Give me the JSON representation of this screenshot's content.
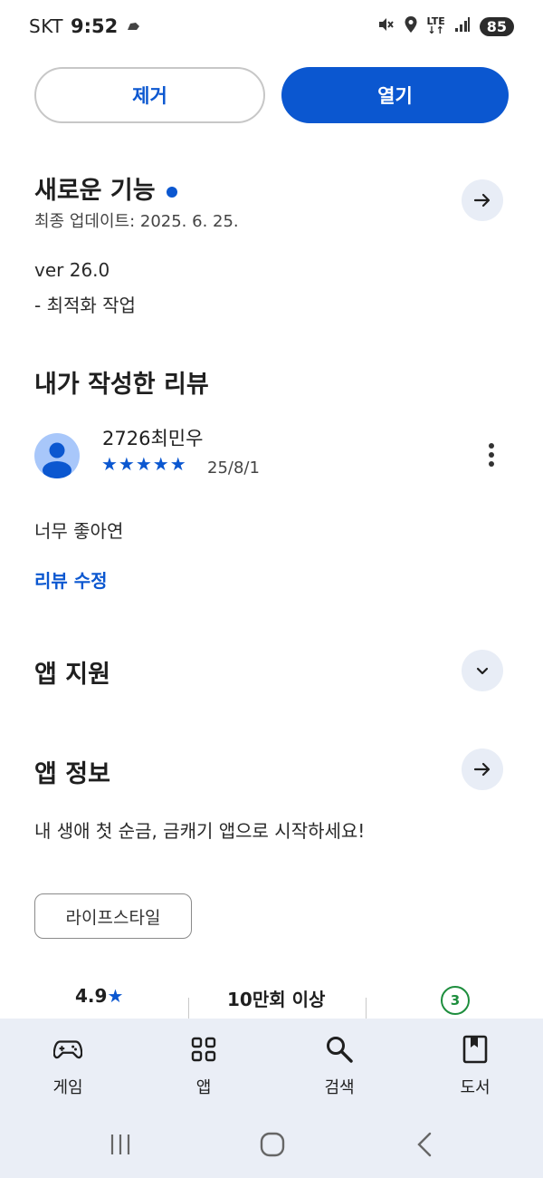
{
  "status_bar": {
    "carrier": "SKT",
    "time": "9:52",
    "network": "LTE",
    "battery": "85"
  },
  "actions": {
    "remove_label": "제거",
    "open_label": "열기"
  },
  "whats_new": {
    "title": "새로운 기능",
    "last_updated": "최종 업데이트: 2025. 6. 25.",
    "version": "ver 26.0",
    "note": "- 최적화 작업"
  },
  "my_review": {
    "title": "내가 작성한 리뷰",
    "reviewer": "2726최민우",
    "stars": "★★★★★",
    "rating": 5,
    "date": "25/8/1",
    "text": "너무 좋아연",
    "edit_label": "리뷰 수정"
  },
  "app_support": {
    "title": "앱 지원"
  },
  "app_info": {
    "title": "앱 정보",
    "description": "내 생애 첫 순금, 금캐기 앱으로 시작하세요!",
    "category_chip": "라이프스타일"
  },
  "stats": {
    "rating": "4.9",
    "rating_star": "★",
    "downloads": "10만회 이상",
    "content_rating": "3"
  },
  "bottom_nav": {
    "items": [
      {
        "label": "게임",
        "icon": "gamepad-icon"
      },
      {
        "label": "앱",
        "icon": "apps-grid-icon"
      },
      {
        "label": "검색",
        "icon": "search-icon"
      },
      {
        "label": "도서",
        "icon": "book-icon"
      }
    ]
  },
  "colors": {
    "accent": "#0b57d0",
    "nav_background": "#eaeef6",
    "rating_green": "#1e8e3e"
  }
}
